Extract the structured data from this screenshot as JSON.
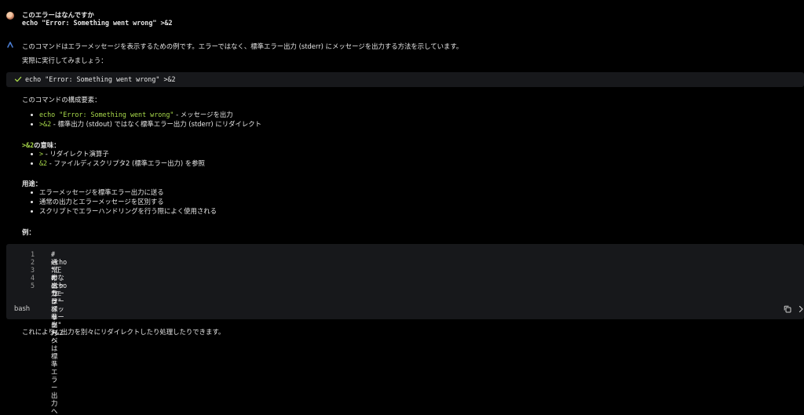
{
  "user_message": {
    "line1": "このエラーはなんですか",
    "line2": "echo \"Error: Something went wrong\" >&2"
  },
  "assistant": {
    "intro": "このコマンドはエラーメッセージを表示するための例です。エラーではなく、標準エラー出力 (stderr) にメッセージを出力する方法を示しています。",
    "run_prompt": "実際に実行してみましょう：",
    "command": "echo \"Error: Something went wrong\" >&2",
    "components_heading": "このコマンドの構成要素：",
    "components": [
      {
        "code": "echo \"Error: Something went wrong\"",
        "text": " - メッセージを出力"
      },
      {
        "code": ">&2",
        "text": " - 標準出力 (stdout) ではなく標準エラー出力 (stderr) にリダイレクト"
      }
    ],
    "meaning_heading_code": ">&2",
    "meaning_heading_text": "の意味：",
    "meanings": [
      {
        "code": ">",
        "text": " - リダイレクト演算子"
      },
      {
        "code": "&2",
        "text": " - ファイルディスクリプタ2 (標準エラー出力) を参照"
      }
    ],
    "uses_heading": "用途：",
    "uses": [
      "エラーメッセージを標準エラー出力に送る",
      "通常の出力とエラーメッセージを区別する",
      "スクリプトでエラーハンドリングを行う際によく使用される"
    ],
    "example_heading": "例：",
    "code_block": {
      "lines": [
        {
          "num": "1",
          "text": "# 通常の出力は標準出力へ"
        },
        {
          "num": "2",
          "text": "echo \"正常なメッセージ\""
        },
        {
          "num": "3",
          "text": ""
        },
        {
          "num": "4",
          "text": "# エラーメッセージは標準エラー出力へ"
        },
        {
          "num": "5",
          "text": "echo \"エラーメッセージ\" >&2"
        }
      ],
      "language": "bash"
    },
    "conclusion": "これにより、出力を別々にリダイレクトしたり処理したりできます。"
  },
  "icons": {
    "avatar": "user-avatar",
    "assistant": "assistant-logo-icon",
    "check": "check-icon",
    "copy": "copy-icon",
    "more": "chevron-right-icon"
  },
  "colors": {
    "background": "#000000",
    "panel": "#17181b",
    "accent_green": "#a8d94a",
    "text": "#e6e6e6",
    "assistant_icon": "#4a7bd0"
  }
}
